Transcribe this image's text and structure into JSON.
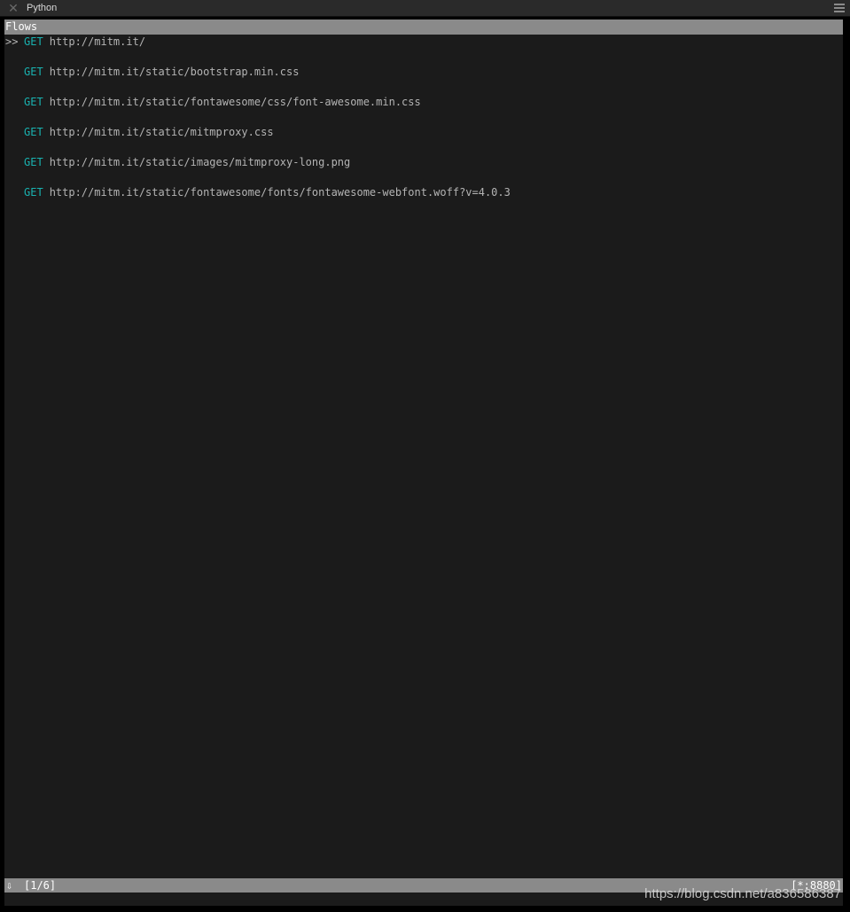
{
  "window": {
    "title": "Python",
    "close_glyph": "✕",
    "close_icon": "close-icon",
    "menu_icon": "hamburger-menu-icon"
  },
  "header": {
    "title": "Flows"
  },
  "flows": [
    {
      "cursor": ">>",
      "method": "GET",
      "url": "http://mitm.it/",
      "selected": true
    },
    {
      "cursor": "",
      "method": "GET",
      "url": "http://mitm.it/static/bootstrap.min.css",
      "selected": false
    },
    {
      "cursor": "",
      "method": "GET",
      "url": "http://mitm.it/static/fontawesome/css/font-awesome.min.css",
      "selected": false
    },
    {
      "cursor": "",
      "method": "GET",
      "url": "http://mitm.it/static/mitmproxy.css",
      "selected": false
    },
    {
      "cursor": "",
      "method": "GET",
      "url": "http://mitm.it/static/images/mitmproxy-long.png",
      "selected": false
    },
    {
      "cursor": "",
      "method": "GET",
      "url": "http://mitm.it/static/fontawesome/fonts/fontawesome-webfont.woff?v=4.0.3",
      "selected": false
    }
  ],
  "status": {
    "arrow": "⇩",
    "arrow_icon": "down-arrow-icon",
    "count": "[1/6]",
    "port": "[*:8880]"
  },
  "watermark": "https://blog.csdn.net/a836586387",
  "colors": {
    "method": "#19b2b0",
    "bar": "#8a8a8a",
    "background": "#1b1b1b"
  }
}
